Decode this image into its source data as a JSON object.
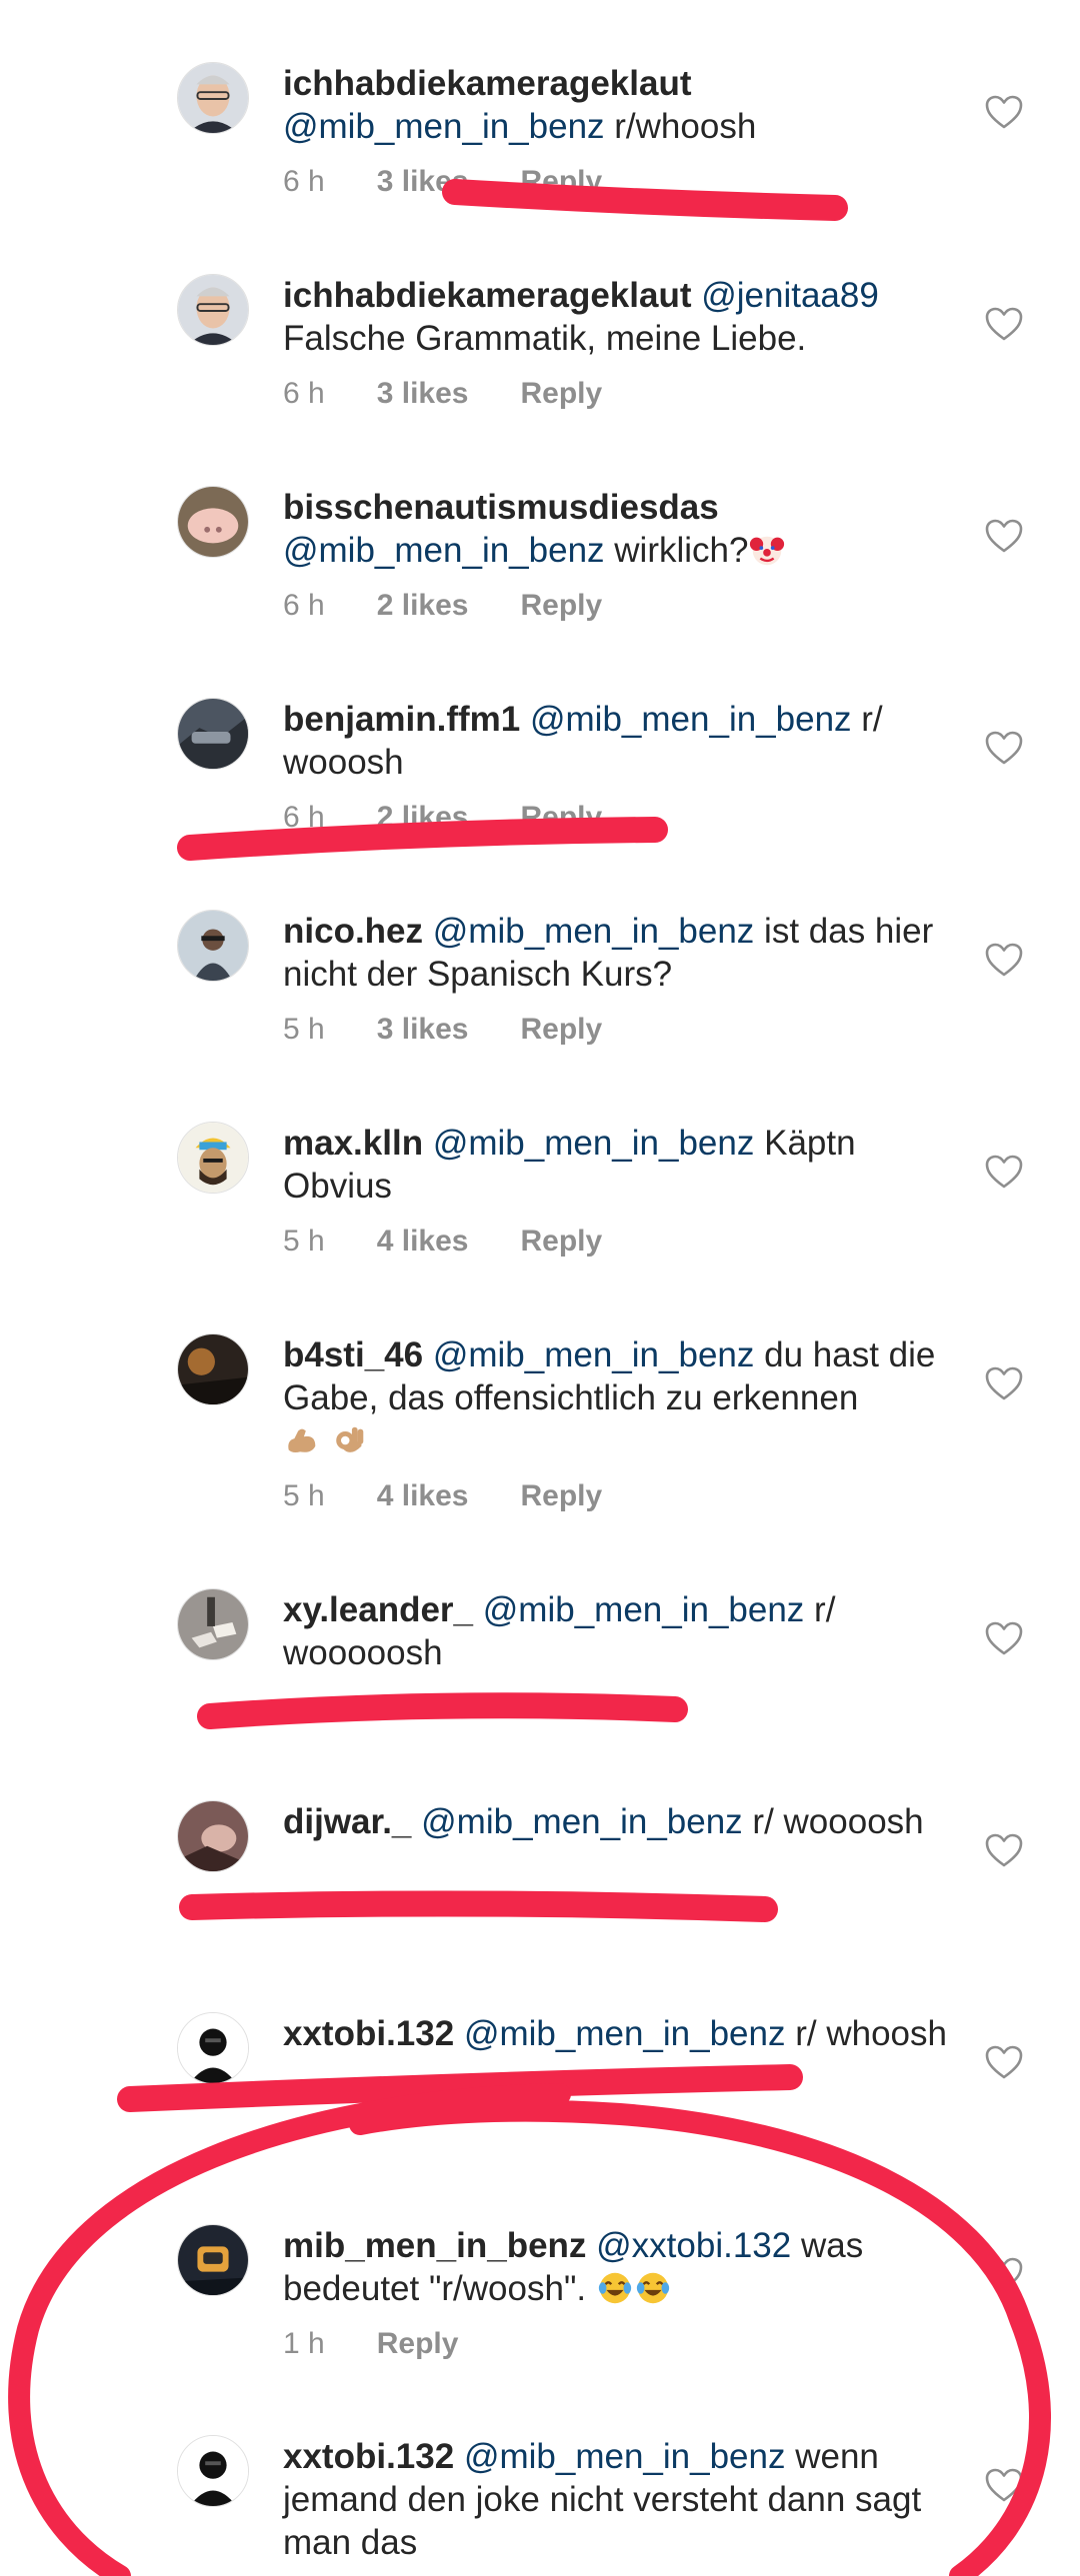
{
  "comments": [
    {
      "username": "ichhabdiekamerageklaut",
      "mention": "@mib_men_in_benz",
      "text": "r/whoosh",
      "time": "6 h",
      "likes": "3 likes",
      "reply": "Reply"
    },
    {
      "username": "ichhabdiekamerageklaut",
      "mention": "@jenitaa89",
      "text": "Falsche Grammatik, meine Liebe.",
      "time": "6 h",
      "likes": "3 likes",
      "reply": "Reply"
    },
    {
      "username": "bisschenautismusdiesdas",
      "mention": "@mib_men_in_benz",
      "text": "wirklich?",
      "emoji": "clown-face",
      "time": "6 h",
      "likes": "2 likes",
      "reply": "Reply"
    },
    {
      "username": "benjamin.ffm1",
      "mention": "@mib_men_in_benz",
      "text": "r/ wooosh",
      "time": "6 h",
      "likes": "2 likes",
      "reply": "Reply"
    },
    {
      "username": "nico.hez",
      "mention": "@mib_men_in_benz",
      "text": "ist das hier nicht der Spanisch Kurs?",
      "time": "5 h",
      "likes": "3 likes",
      "reply": "Reply"
    },
    {
      "username": "max.klln",
      "mention": "@mib_men_in_benz",
      "text": "Käptn Obvius",
      "time": "5 h",
      "likes": "4 likes",
      "reply": "Reply"
    },
    {
      "username": "b4sti_46",
      "mention": "@mib_men_in_benz",
      "text": "du hast die Gabe, das offensichtlich zu erkennen",
      "emoji": "flexed-biceps, ok-hand",
      "time": "5 h",
      "likes": "4 likes",
      "reply": "Reply"
    },
    {
      "username": "xy.leander_",
      "mention": "@mib_men_in_benz",
      "text": "r/ wooooosh",
      "time": "",
      "likes": "",
      "reply": ""
    },
    {
      "username": "dijwar._",
      "mention": "@mib_men_in_benz",
      "text": "r/ woooosh",
      "time": "",
      "likes": "",
      "reply": ""
    },
    {
      "username": "xxtobi.132",
      "mention": "@mib_men_in_benz",
      "text": "r/ whoosh",
      "time": "",
      "likes": "",
      "reply": ""
    },
    {
      "username": "mib_men_in_benz",
      "mention": "@xxtobi.132",
      "text": "was bedeutet \"r/woosh\".",
      "emoji": "tears-of-joy x2",
      "time": "1 h",
      "likes": "",
      "reply": "Reply"
    },
    {
      "username": "xxtobi.132",
      "mention": "@mib_men_in_benz",
      "text": "wenn jemand den joke nicht versteht dann sagt man das",
      "time": "",
      "likes": "",
      "reply": ""
    }
  ],
  "colors": {
    "mention": "#0b3a63",
    "meta": "#8e8e8e",
    "annotation_red": "#f2274a"
  }
}
